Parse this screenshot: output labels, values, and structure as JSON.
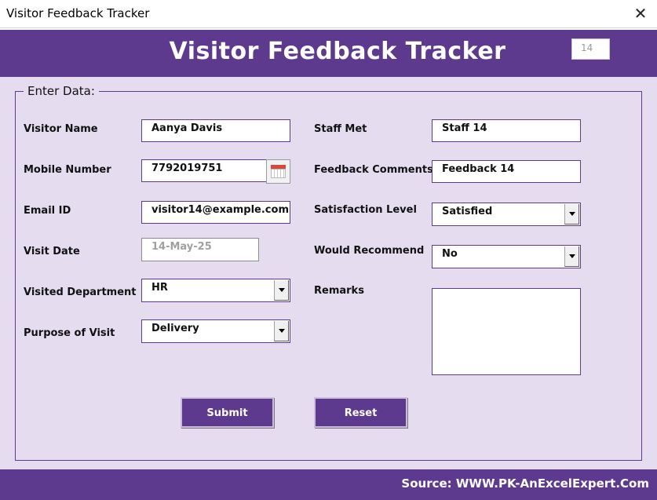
{
  "window": {
    "title": "Visitor Feedback Tracker",
    "close_glyph": "✕"
  },
  "header": {
    "title": "Visitor Feedback Tracker",
    "record_id": "14"
  },
  "form": {
    "section_label": "Enter Data:",
    "left": {
      "visitor_name": {
        "label": "Visitor Name",
        "value": "Aanya Davis"
      },
      "mobile_number": {
        "label": "Mobile Number",
        "value": "7792019751"
      },
      "email_id": {
        "label": "Email ID",
        "value": "visitor14@example.com"
      },
      "visit_date": {
        "label": "Visit Date",
        "value": "14-May-25"
      },
      "visited_department": {
        "label": "Visited Department",
        "value": "HR"
      },
      "purpose_of_visit": {
        "label": "Purpose of Visit",
        "value": "Delivery"
      }
    },
    "right": {
      "staff_met": {
        "label": "Staff Met",
        "value": "Staff 14"
      },
      "feedback_comments": {
        "label": "Feedback Comments",
        "value": "Feedback 14"
      },
      "satisfaction_level": {
        "label": "Satisfaction Level",
        "value": "Satisfied"
      },
      "would_recommend": {
        "label": "Would Recommend",
        "value": "No"
      },
      "remarks": {
        "label": "Remarks",
        "value": ""
      }
    },
    "buttons": {
      "submit": "Submit",
      "reset": "Reset"
    }
  },
  "footer": {
    "source": "Source: WWW.PK-AnExcelExpert.Com"
  },
  "icons": {
    "calendar": "calendar-icon",
    "close": "close-icon",
    "dropdown": "chevron-down-icon"
  },
  "colors": {
    "brand_purple": "#5e3a8e",
    "panel_lavender": "#e6dcf0"
  }
}
